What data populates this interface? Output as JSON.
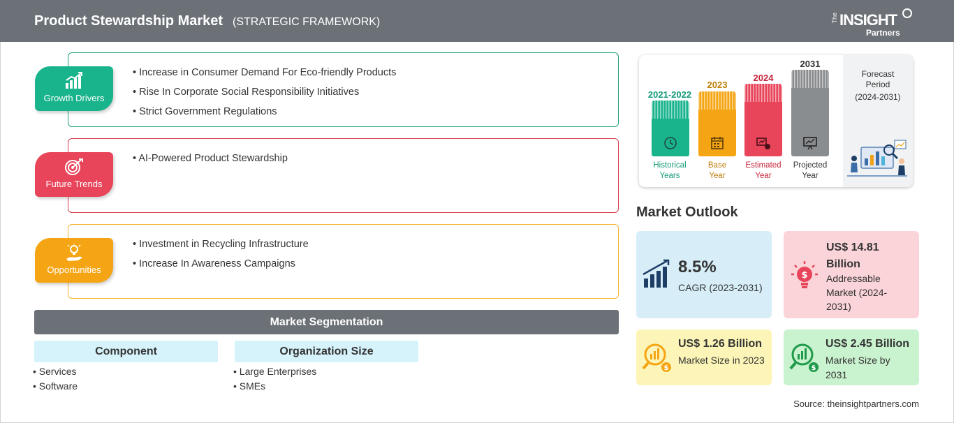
{
  "header": {
    "title": "Product Stewardship Market",
    "subtitle": "(STRATEGIC FRAMEWORK)",
    "logo": {
      "the": "The",
      "insight": "INSIGHT",
      "partners": "Partners"
    }
  },
  "growth_drivers": {
    "label": "Growth Drivers",
    "color": "#19b38c",
    "items": [
      "Increase in Consumer Demand For Eco-friendly Products",
      "Rise In Corporate Social Responsibility Initiatives",
      "Strict Government Regulations"
    ]
  },
  "future_trends": {
    "label": "Future Trends",
    "color": "#e8445a",
    "items": [
      "AI-Powered Product Stewardship"
    ]
  },
  "opportunities": {
    "label": "Opportunities",
    "color": "#f5a514",
    "items": [
      "Investment in Recycling Infrastructure",
      "Increase In Awareness Campaigns"
    ]
  },
  "segmentation": {
    "title": "Market Segmentation",
    "groups": [
      {
        "title": "Component",
        "items": [
          "Services",
          "Software"
        ]
      },
      {
        "title": "Organization Size",
        "items": [
          "Large Enterprises",
          "SMEs"
        ]
      }
    ]
  },
  "timeline": {
    "bars": [
      {
        "year": "2021-2022",
        "label_line1": "Historical",
        "label_line2": "Years",
        "color": "#19b38c",
        "icon": "history-icon"
      },
      {
        "year": "2023",
        "label_line1": "Base",
        "label_line2": "Year",
        "color": "#f5a514",
        "icon": "calendar-icon"
      },
      {
        "year": "2024",
        "label_line1": "Estimated",
        "label_line2": "Year",
        "color": "#e8445a",
        "icon": "analytics-icon"
      },
      {
        "year": "2031",
        "label_line1": "Projected",
        "label_line2": "Year",
        "color": "#8a8d90",
        "icon": "presentation-icon"
      }
    ],
    "forecast": {
      "line1": "Forecast",
      "line2": "Period",
      "line3": "(2024-2031)"
    }
  },
  "market_outlook": {
    "title": "Market Outlook",
    "cagr": {
      "value": "8.5%",
      "label": "CAGR (2023-2031)"
    },
    "addressable": {
      "value": "US$ 14.81 Billion",
      "label": "Addressable Market (2024-2031)"
    },
    "size_2023": {
      "value": "US$ 1.26 Billion",
      "label": "Market Size in 2023"
    },
    "size_2031": {
      "value": "US$ 2.45 Billion",
      "label": "Market Size by 2031"
    }
  },
  "source": "Source: theinsightpartners.com"
}
